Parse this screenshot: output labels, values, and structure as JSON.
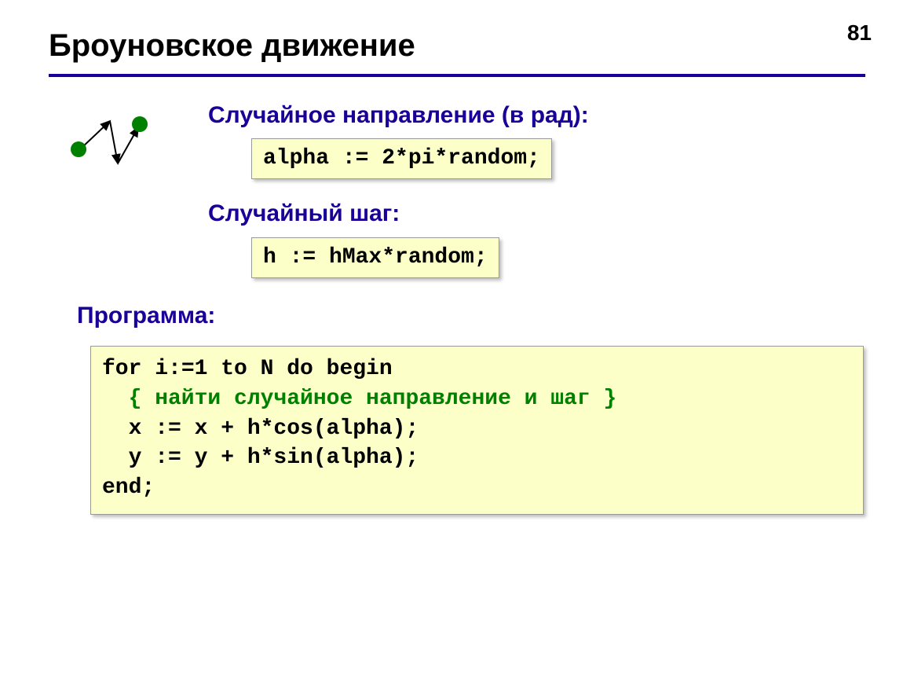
{
  "page_number": "81",
  "title": "Броуновское движение",
  "section1_label": "Случайное направление (в рад):",
  "code1": "alpha := 2*pi*random;",
  "section2_label": "Случайный шаг:",
  "code2": "h := hMax*random;",
  "section3_label": "Программа:",
  "code3": {
    "line1": "for i:=1 to N do begin",
    "line2_comment": "{ найти случайное направление и шаг }",
    "line3": "x := x + h*cos(alpha);",
    "line4": "y := y + h*sin(alpha);",
    "line5": "end;"
  }
}
